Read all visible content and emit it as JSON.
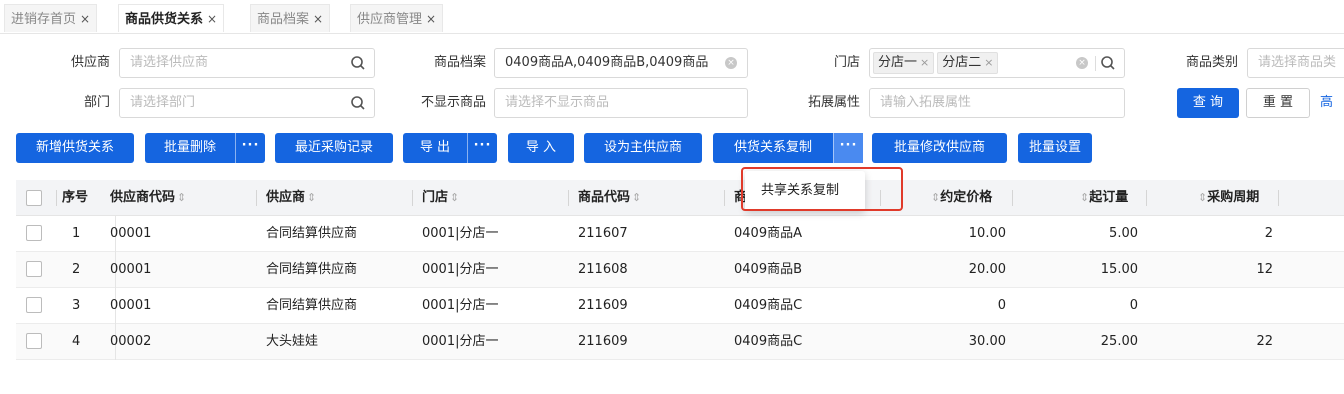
{
  "tabs": [
    {
      "label": "进销存首页"
    },
    {
      "label": "商品供货关系"
    },
    {
      "label": "商品档案"
    },
    {
      "label": "供应商管理"
    }
  ],
  "close_glyph": "×",
  "filters": {
    "supplier": {
      "label": "供应商",
      "placeholder": "请选择供应商"
    },
    "product_file": {
      "label": "商品档案",
      "value": "0409商品A,0409商品B,0409商品"
    },
    "store": {
      "label": "门店",
      "chips": [
        "分店一",
        "分店二"
      ]
    },
    "product_category": {
      "label": "商品类别",
      "placeholder": "请选择商品类"
    },
    "department": {
      "label": "部门",
      "placeholder": "请选择部门"
    },
    "hidden_products": {
      "label": "不显示商品",
      "placeholder": "请选择不显示商品"
    },
    "extended_attr": {
      "label": "拓展属性",
      "placeholder": "请输入拓展属性"
    }
  },
  "query_button": "查 询",
  "reset_button": "重 置",
  "advanced_link": "高级",
  "toolbar": {
    "add": "新增供货关系",
    "batch_delete": "批量删除",
    "recent_purchase": "最近采购记录",
    "export": "导 出",
    "import": "导 入",
    "set_main": "设为主供应商",
    "copy_relation": "供货关系复制",
    "batch_modify_supplier": "批量修改供应商",
    "batch_settings": "批量设置",
    "more": "···"
  },
  "dropdown": {
    "item": "共享关系复制"
  },
  "table": {
    "columns": {
      "index": "序号",
      "supplier_code": "供应商代码",
      "supplier": "供应商",
      "store": "门店",
      "product_code": "商品代码",
      "product_name": "商",
      "agreed_price": "约定价格",
      "min_order": "起订量",
      "purchase_cycle": "采购周期"
    },
    "sort_glyph": "⇕",
    "rows": [
      {
        "index": "1",
        "supplier_code": "00001",
        "supplier": "合同结算供应商",
        "store": "0001|分店一",
        "product_code": "211607",
        "product_name": "0409商品A",
        "agreed_price": "10.00",
        "min_order": "5.00",
        "purchase_cycle": "2"
      },
      {
        "index": "2",
        "supplier_code": "00001",
        "supplier": "合同结算供应商",
        "store": "0001|分店一",
        "product_code": "211608",
        "product_name": "0409商品B",
        "agreed_price": "20.00",
        "min_order": "15.00",
        "purchase_cycle": "12"
      },
      {
        "index": "3",
        "supplier_code": "00001",
        "supplier": "合同结算供应商",
        "store": "0001|分店一",
        "product_code": "211609",
        "product_name": "0409商品C",
        "agreed_price": "0",
        "min_order": "0",
        "purchase_cycle": ""
      },
      {
        "index": "4",
        "supplier_code": "00002",
        "supplier": "大头娃娃",
        "store": "0001|分店一",
        "product_code": "211609",
        "product_name": "0409商品C",
        "agreed_price": "30.00",
        "min_order": "25.00",
        "purchase_cycle": "22"
      }
    ]
  },
  "colors": {
    "primary": "#1565e0",
    "highlight": "#e03a2a"
  }
}
